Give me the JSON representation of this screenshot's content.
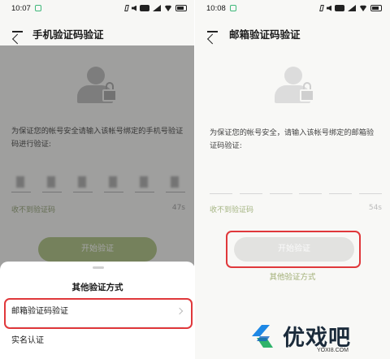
{
  "left": {
    "status_time": "10:07",
    "title": "手机验证码验证",
    "description": "为保证您的帐号安全请输入该帐号绑定的手机号验证码进行验证:",
    "resend_label": "收不到验证码",
    "countdown": "47s",
    "start_button": "开始验证",
    "sheet": {
      "title": "其他验证方式",
      "options": [
        {
          "label": "邮箱验证码验证",
          "highlighted": true
        },
        {
          "label": "实名认证",
          "highlighted": false
        }
      ]
    }
  },
  "right": {
    "status_time": "10:08",
    "title": "邮箱验证码验证",
    "description": "为保证您的帐号安全，请输入该帐号绑定的邮箱验证码验证:",
    "resend_label": "收不到验证码",
    "countdown": "54s",
    "start_button": "开始验证",
    "other_methods": "其他验证方式"
  },
  "watermark": {
    "brand": "优戏吧",
    "url": "YOXI8.COM"
  },
  "colors": {
    "highlight": "#e0383b",
    "accent_green": "#a9bf7a",
    "brand_blue": "#1e88e5",
    "brand_green": "#2fb36a"
  }
}
